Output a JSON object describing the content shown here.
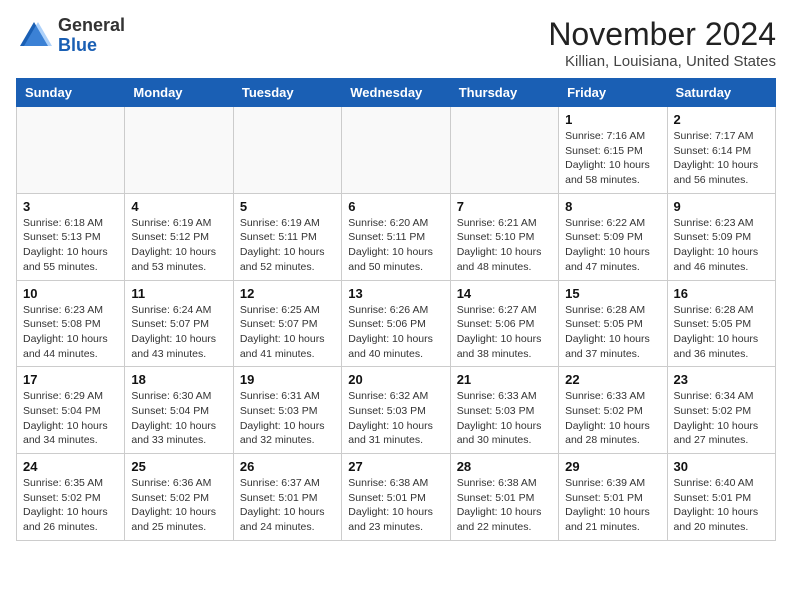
{
  "header": {
    "logo_line1": "General",
    "logo_line2": "Blue",
    "month_year": "November 2024",
    "location": "Killian, Louisiana, United States"
  },
  "weekdays": [
    "Sunday",
    "Monday",
    "Tuesday",
    "Wednesday",
    "Thursday",
    "Friday",
    "Saturday"
  ],
  "weeks": [
    [
      {
        "day": "",
        "info": ""
      },
      {
        "day": "",
        "info": ""
      },
      {
        "day": "",
        "info": ""
      },
      {
        "day": "",
        "info": ""
      },
      {
        "day": "",
        "info": ""
      },
      {
        "day": "1",
        "info": "Sunrise: 7:16 AM\nSunset: 6:15 PM\nDaylight: 10 hours\nand 58 minutes."
      },
      {
        "day": "2",
        "info": "Sunrise: 7:17 AM\nSunset: 6:14 PM\nDaylight: 10 hours\nand 56 minutes."
      }
    ],
    [
      {
        "day": "3",
        "info": "Sunrise: 6:18 AM\nSunset: 5:13 PM\nDaylight: 10 hours\nand 55 minutes."
      },
      {
        "day": "4",
        "info": "Sunrise: 6:19 AM\nSunset: 5:12 PM\nDaylight: 10 hours\nand 53 minutes."
      },
      {
        "day": "5",
        "info": "Sunrise: 6:19 AM\nSunset: 5:11 PM\nDaylight: 10 hours\nand 52 minutes."
      },
      {
        "day": "6",
        "info": "Sunrise: 6:20 AM\nSunset: 5:11 PM\nDaylight: 10 hours\nand 50 minutes."
      },
      {
        "day": "7",
        "info": "Sunrise: 6:21 AM\nSunset: 5:10 PM\nDaylight: 10 hours\nand 48 minutes."
      },
      {
        "day": "8",
        "info": "Sunrise: 6:22 AM\nSunset: 5:09 PM\nDaylight: 10 hours\nand 47 minutes."
      },
      {
        "day": "9",
        "info": "Sunrise: 6:23 AM\nSunset: 5:09 PM\nDaylight: 10 hours\nand 46 minutes."
      }
    ],
    [
      {
        "day": "10",
        "info": "Sunrise: 6:23 AM\nSunset: 5:08 PM\nDaylight: 10 hours\nand 44 minutes."
      },
      {
        "day": "11",
        "info": "Sunrise: 6:24 AM\nSunset: 5:07 PM\nDaylight: 10 hours\nand 43 minutes."
      },
      {
        "day": "12",
        "info": "Sunrise: 6:25 AM\nSunset: 5:07 PM\nDaylight: 10 hours\nand 41 minutes."
      },
      {
        "day": "13",
        "info": "Sunrise: 6:26 AM\nSunset: 5:06 PM\nDaylight: 10 hours\nand 40 minutes."
      },
      {
        "day": "14",
        "info": "Sunrise: 6:27 AM\nSunset: 5:06 PM\nDaylight: 10 hours\nand 38 minutes."
      },
      {
        "day": "15",
        "info": "Sunrise: 6:28 AM\nSunset: 5:05 PM\nDaylight: 10 hours\nand 37 minutes."
      },
      {
        "day": "16",
        "info": "Sunrise: 6:28 AM\nSunset: 5:05 PM\nDaylight: 10 hours\nand 36 minutes."
      }
    ],
    [
      {
        "day": "17",
        "info": "Sunrise: 6:29 AM\nSunset: 5:04 PM\nDaylight: 10 hours\nand 34 minutes."
      },
      {
        "day": "18",
        "info": "Sunrise: 6:30 AM\nSunset: 5:04 PM\nDaylight: 10 hours\nand 33 minutes."
      },
      {
        "day": "19",
        "info": "Sunrise: 6:31 AM\nSunset: 5:03 PM\nDaylight: 10 hours\nand 32 minutes."
      },
      {
        "day": "20",
        "info": "Sunrise: 6:32 AM\nSunset: 5:03 PM\nDaylight: 10 hours\nand 31 minutes."
      },
      {
        "day": "21",
        "info": "Sunrise: 6:33 AM\nSunset: 5:03 PM\nDaylight: 10 hours\nand 30 minutes."
      },
      {
        "day": "22",
        "info": "Sunrise: 6:33 AM\nSunset: 5:02 PM\nDaylight: 10 hours\nand 28 minutes."
      },
      {
        "day": "23",
        "info": "Sunrise: 6:34 AM\nSunset: 5:02 PM\nDaylight: 10 hours\nand 27 minutes."
      }
    ],
    [
      {
        "day": "24",
        "info": "Sunrise: 6:35 AM\nSunset: 5:02 PM\nDaylight: 10 hours\nand 26 minutes."
      },
      {
        "day": "25",
        "info": "Sunrise: 6:36 AM\nSunset: 5:02 PM\nDaylight: 10 hours\nand 25 minutes."
      },
      {
        "day": "26",
        "info": "Sunrise: 6:37 AM\nSunset: 5:01 PM\nDaylight: 10 hours\nand 24 minutes."
      },
      {
        "day": "27",
        "info": "Sunrise: 6:38 AM\nSunset: 5:01 PM\nDaylight: 10 hours\nand 23 minutes."
      },
      {
        "day": "28",
        "info": "Sunrise: 6:38 AM\nSunset: 5:01 PM\nDaylight: 10 hours\nand 22 minutes."
      },
      {
        "day": "29",
        "info": "Sunrise: 6:39 AM\nSunset: 5:01 PM\nDaylight: 10 hours\nand 21 minutes."
      },
      {
        "day": "30",
        "info": "Sunrise: 6:40 AM\nSunset: 5:01 PM\nDaylight: 10 hours\nand 20 minutes."
      }
    ]
  ]
}
